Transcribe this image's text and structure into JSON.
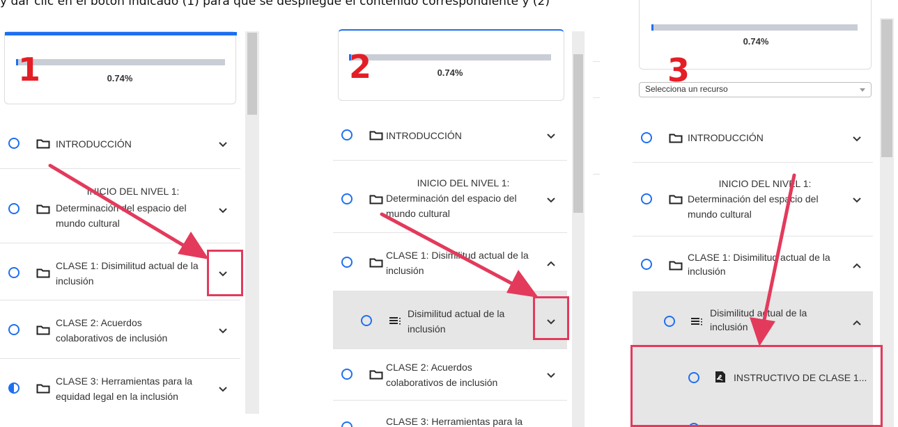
{
  "caption": "y dar clic en el botón indicado (1) para que se despliegue el contenido correspondiente y (2)",
  "steps": [
    "1",
    "2",
    "3"
  ],
  "progress": {
    "value": 0.74,
    "label": "0.74%"
  },
  "select": {
    "value": "Selecciona un recurso"
  },
  "items": {
    "intro": "INTRODUCCIÓN",
    "nivel1": [
      "INICIO DEL NIVEL 1:",
      "Determinación del espacio del",
      "mundo cultural"
    ],
    "clase1": [
      "CLASE 1: Disimilitud actual de la",
      "inclusión"
    ],
    "sub1": [
      "Disimilitud actual de la",
      "inclusión"
    ],
    "clase2": [
      "CLASE 2: Acuerdos",
      "colaborativos de inclusión"
    ],
    "clase3": [
      "CLASE 3: Herramientas para la",
      "equidad legal en la inclusión"
    ],
    "clase3_partial": "CLASE 3: Herramientas para la",
    "resource": "INSTRUCTIVO DE CLASE 1..."
  },
  "colors": {
    "accent": "#1e6ff1",
    "highlight": "#e33a5c",
    "step": "#e41e26"
  },
  "icons": [
    "folder-icon",
    "list-icon",
    "pdf-icon",
    "chevron-down-icon",
    "chevron-up-icon",
    "circle-status-icon"
  ]
}
